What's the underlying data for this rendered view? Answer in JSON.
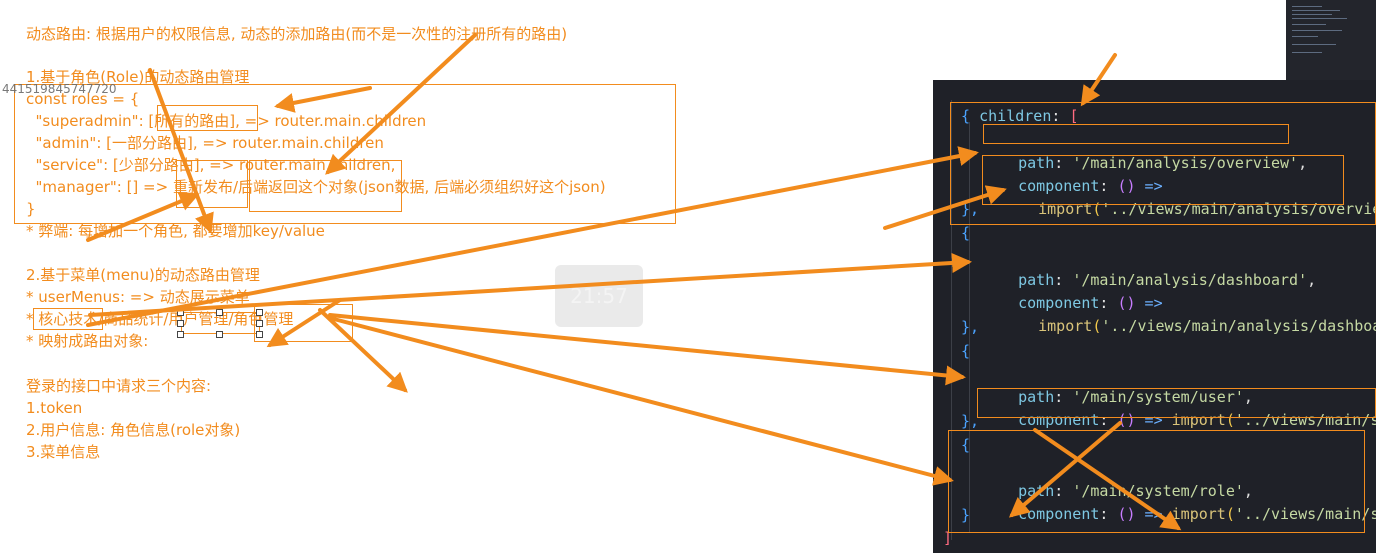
{
  "notes": {
    "line1": "动态路由: 根据用户的权限信息, 动态的添加路由(而不是一次性的注册所有的路由)",
    "line2": "1.基于角色(Role)的动态路由管理",
    "line3": "const roles = {",
    "line4": "  \"superadmin\": [所有的路由], => router.main.children",
    "line5": "  \"admin\": [一部分路由], => router.main.children",
    "line6": "  \"service\": [少部分路由], => router.main.children,",
    "line7": "  \"manager\": [] => 重新发布/后端返回这个对象(json数据, 后端必须组织好这个json)",
    "line8": "}",
    "line9": "* 弊端: 每增加一个角色, 都要增加key/value",
    "line10": "2.基于菜单(menu)的动态路由管理",
    "line11": "* userMenus: => 动态展示菜单",
    "line12": "* 核心技术/商品统计/用户管理/角色管理",
    "line13": "* 映射成路由对象:",
    "line14": "登录的接口中请求三个内容:",
    "line15": "1.token",
    "line16": "2.用户信息: 角色信息(role对象)",
    "line17": "3.菜单信息"
  },
  "watermark_id": "441519845747720",
  "timer": "21:57",
  "code": {
    "l1": [
      "children",
      ":",
      "["
    ],
    "l2": "{",
    "l3": [
      "path",
      ": ",
      "'/main/analysis/overview'",
      ","
    ],
    "l4": [
      "component",
      ": ",
      "()",
      " => "
    ],
    "l5": [
      "import",
      "(",
      "'../views/main/analysis/overview",
      ""
    ],
    "l6": "},",
    "l7": "{",
    "l8": [
      "path",
      ": ",
      "'/main/analysis/dashboard'",
      ","
    ],
    "l9": [
      "component",
      ": ",
      "()",
      " => "
    ],
    "l10": [
      "import",
      "(",
      "'../views/main/analysis/dashboar",
      ""
    ],
    "l11": "},",
    "l12": "{",
    "l13": [
      "path",
      ": ",
      "'/main/system/user'",
      ","
    ],
    "l14": [
      "component",
      ": ",
      "()",
      " => ",
      "import",
      "(",
      "'../views/main/sy"
    ],
    "l15": "},",
    "l16": "{",
    "l17": [
      "path",
      ": ",
      "'/main/system/role'",
      ","
    ],
    "l18": [
      "component",
      ": ",
      "()",
      " => ",
      "import",
      "(",
      "'../views/main/sy"
    ],
    "l19": "}",
    "l20": "]"
  },
  "colors": {
    "annotation": "#f28c1e",
    "code_bg": "#1f2128"
  }
}
